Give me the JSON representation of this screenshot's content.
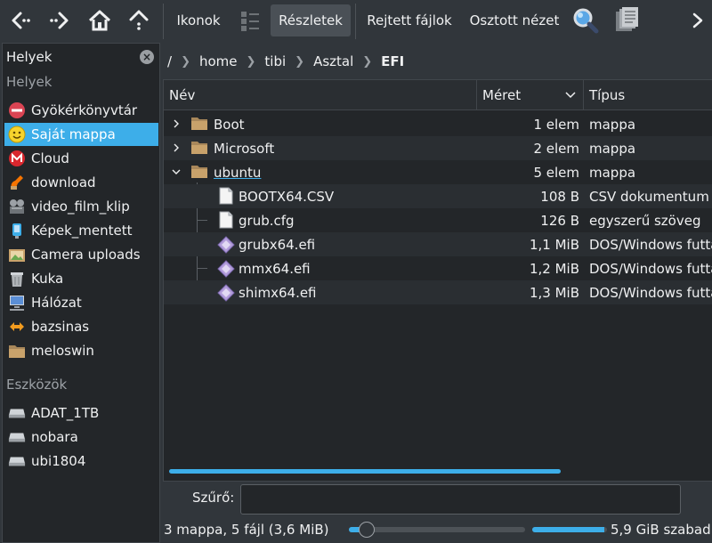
{
  "toolbar": {
    "back_icon": "back-arrow-icon",
    "forward_icon": "forward-arrow-icon",
    "home_icon": "home-icon",
    "up_icon": "up-arrow-icon",
    "icons_label": "Ikonok",
    "compact_icon": "compact-view-icon",
    "details_label": "Részletek",
    "hidden_files_label": "Rejtett fájlok",
    "split_view_label": "Osztott nézet",
    "search_icon": "search-icon",
    "preview_icon": "preview-icon",
    "more_icon": "chevron-right-icon"
  },
  "sidebar": {
    "title": "Helyek",
    "places_section": "Helyek",
    "places": [
      {
        "label": "Gyökérkönyvtár",
        "icon": "stop-icon",
        "color": "#da4453"
      },
      {
        "label": "Saját mappa",
        "icon": "smiley-icon",
        "color": "#f6d32d",
        "selected": true
      },
      {
        "label": "Cloud",
        "icon": "mega-icon",
        "color": "#d9272e"
      },
      {
        "label": "download",
        "icon": "download-icon",
        "color": "#f67400"
      },
      {
        "label": "video_film_klip",
        "icon": "video-icon",
        "color": "#9ca1a6"
      },
      {
        "label": "Képek_mentett",
        "icon": "pictures-icon",
        "color": "#3daee9"
      },
      {
        "label": "Camera uploads",
        "icon": "camera-folder-icon",
        "color": "#c8a26b"
      },
      {
        "label": "Kuka",
        "icon": "trash-icon",
        "color": "#b0b4b8"
      },
      {
        "label": "Hálózat",
        "icon": "network-icon",
        "color": "#5b8fd6"
      },
      {
        "label": "bazsinas",
        "icon": "folder-sync-icon",
        "color": "#f39c1f"
      },
      {
        "label": "meloswin",
        "icon": "folder-icon",
        "color": "#c8a26b"
      }
    ],
    "devices_section": "Eszközök",
    "devices": [
      {
        "label": "ADAT_1TB",
        "icon": "drive-icon"
      },
      {
        "label": "nobara",
        "icon": "drive-icon"
      },
      {
        "label": "ubi1804",
        "icon": "drive-icon"
      }
    ]
  },
  "breadcrumb": {
    "root": "/",
    "items": [
      "home",
      "tibi",
      "Asztal"
    ],
    "current": "EFI"
  },
  "columns": {
    "name": "Név",
    "size": "Méret",
    "type": "Típus"
  },
  "files": [
    {
      "name": "Boot",
      "size": "1 elem",
      "type": "mappa",
      "kind": "folder",
      "depth": 0,
      "expander": "collapsed"
    },
    {
      "name": "Microsoft",
      "size": "2 elem",
      "type": "mappa",
      "kind": "folder",
      "depth": 0,
      "expander": "collapsed"
    },
    {
      "name": "ubuntu",
      "size": "5 elem",
      "type": "mappa",
      "kind": "folder",
      "depth": 0,
      "expander": "expanded"
    },
    {
      "name": "BOOTX64.CSV",
      "size": "108 B",
      "type": "CSV dokumentum",
      "kind": "doc",
      "depth": 1
    },
    {
      "name": "grub.cfg",
      "size": "126 B",
      "type": "egyszerű szöveg",
      "kind": "doc",
      "depth": 1
    },
    {
      "name": "grubx64.efi",
      "size": "1,1 MiB",
      "type": "DOS/Windows futtatható",
      "kind": "exe",
      "depth": 1
    },
    {
      "name": "mmx64.efi",
      "size": "1,2 MiB",
      "type": "DOS/Windows futtatható",
      "kind": "exe",
      "depth": 1
    },
    {
      "name": "shimx64.efi",
      "size": "1,3 MiB",
      "type": "DOS/Windows futtatható",
      "kind": "exe",
      "depth": 1
    }
  ],
  "filter": {
    "label": "Szűrő:",
    "value": "",
    "placeholder": ""
  },
  "status": {
    "summary": "3 mappa, 5 fájl (3,6 MiB)",
    "zoom_level": 0.1,
    "free_space": "5,9 GiB szabad",
    "used_fraction": 0.97
  },
  "colors": {
    "accent": "#3daee9",
    "folder": "#c8a26b"
  }
}
